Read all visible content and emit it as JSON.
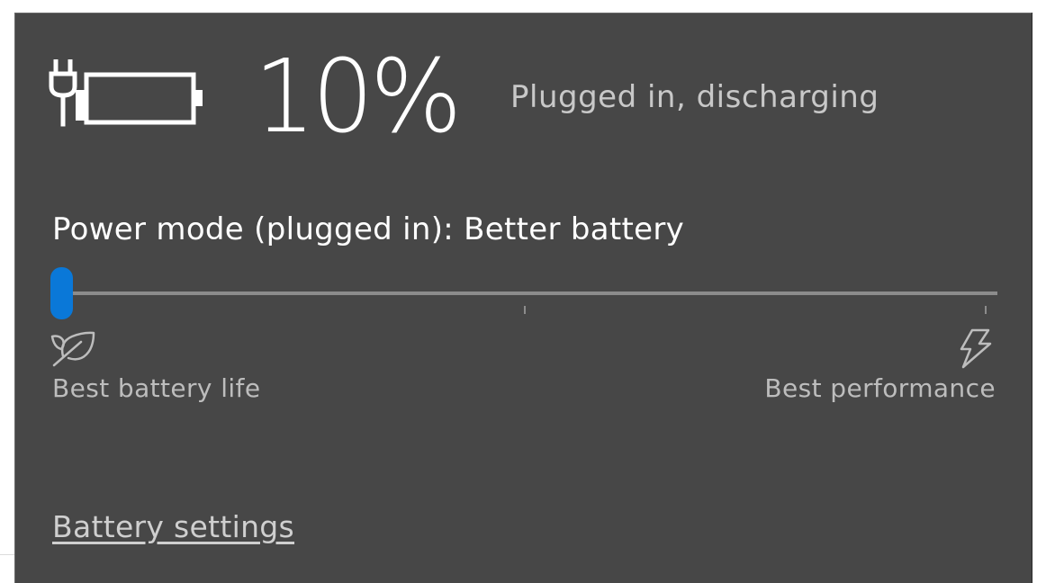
{
  "battery": {
    "percent_label": "10%",
    "percent_value": 10,
    "status": "Plugged in, discharging",
    "icon": "battery-plugged-icon"
  },
  "power_mode": {
    "title": "Power mode (plugged in): Better battery",
    "slider_value": 0,
    "slider_position_label": "Better battery",
    "left_icon": "leaf-icon",
    "right_icon": "lightning-bolt-icon",
    "left_label": "Best battery life",
    "right_label": "Best performance"
  },
  "footer": {
    "link_label": "Battery settings"
  },
  "colors": {
    "background": "#474747",
    "accent": "#0a78d8",
    "text_primary": "#ffffff",
    "text_secondary": "#c8c8c8"
  }
}
